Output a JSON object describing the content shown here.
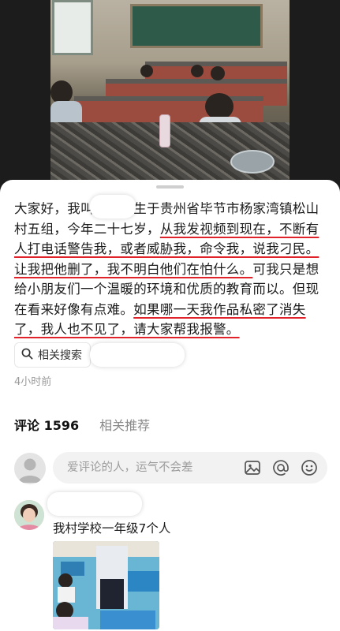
{
  "post": {
    "segments": [
      {
        "text": "大家好，我叫",
        "underline": false
      },
      {
        "text": "　　　",
        "underline": false
      },
      {
        "text": "生于贵州省毕节市杨家湾镇松山村五组，今年二十七岁，",
        "underline": false
      },
      {
        "text": "从我发视频到现在，不断有人打电话警告我，或者威胁我，命令我，说我刁民。让我把他删了，我不明白他们在怕什么。",
        "underline": true
      },
      {
        "text": "可我只是想给小朋友们一个温暖的环境和优质的教育而以。但现在看来好像有点难。",
        "underline": false
      },
      {
        "text": "如果哪一天我作品私密了消失了，我人也不见了，请大家帮我报警。",
        "underline": true
      }
    ],
    "related_search_label": "相关搜索",
    "time": "4小时前"
  },
  "tabs": {
    "comments_label": "评论",
    "comments_count": "1596",
    "related_label": "相关推荐"
  },
  "comment_input": {
    "placeholder": "爱评论的人，运气不会差"
  },
  "icons": [
    "image-icon",
    "at-icon",
    "emoji-icon",
    "search-icon"
  ],
  "first_comment": {
    "text": "我村学校一年级7个人"
  },
  "colors": {
    "underline": "#e0232a",
    "sheet_bg": "#ffffff",
    "input_bg": "#f2f2f2"
  }
}
